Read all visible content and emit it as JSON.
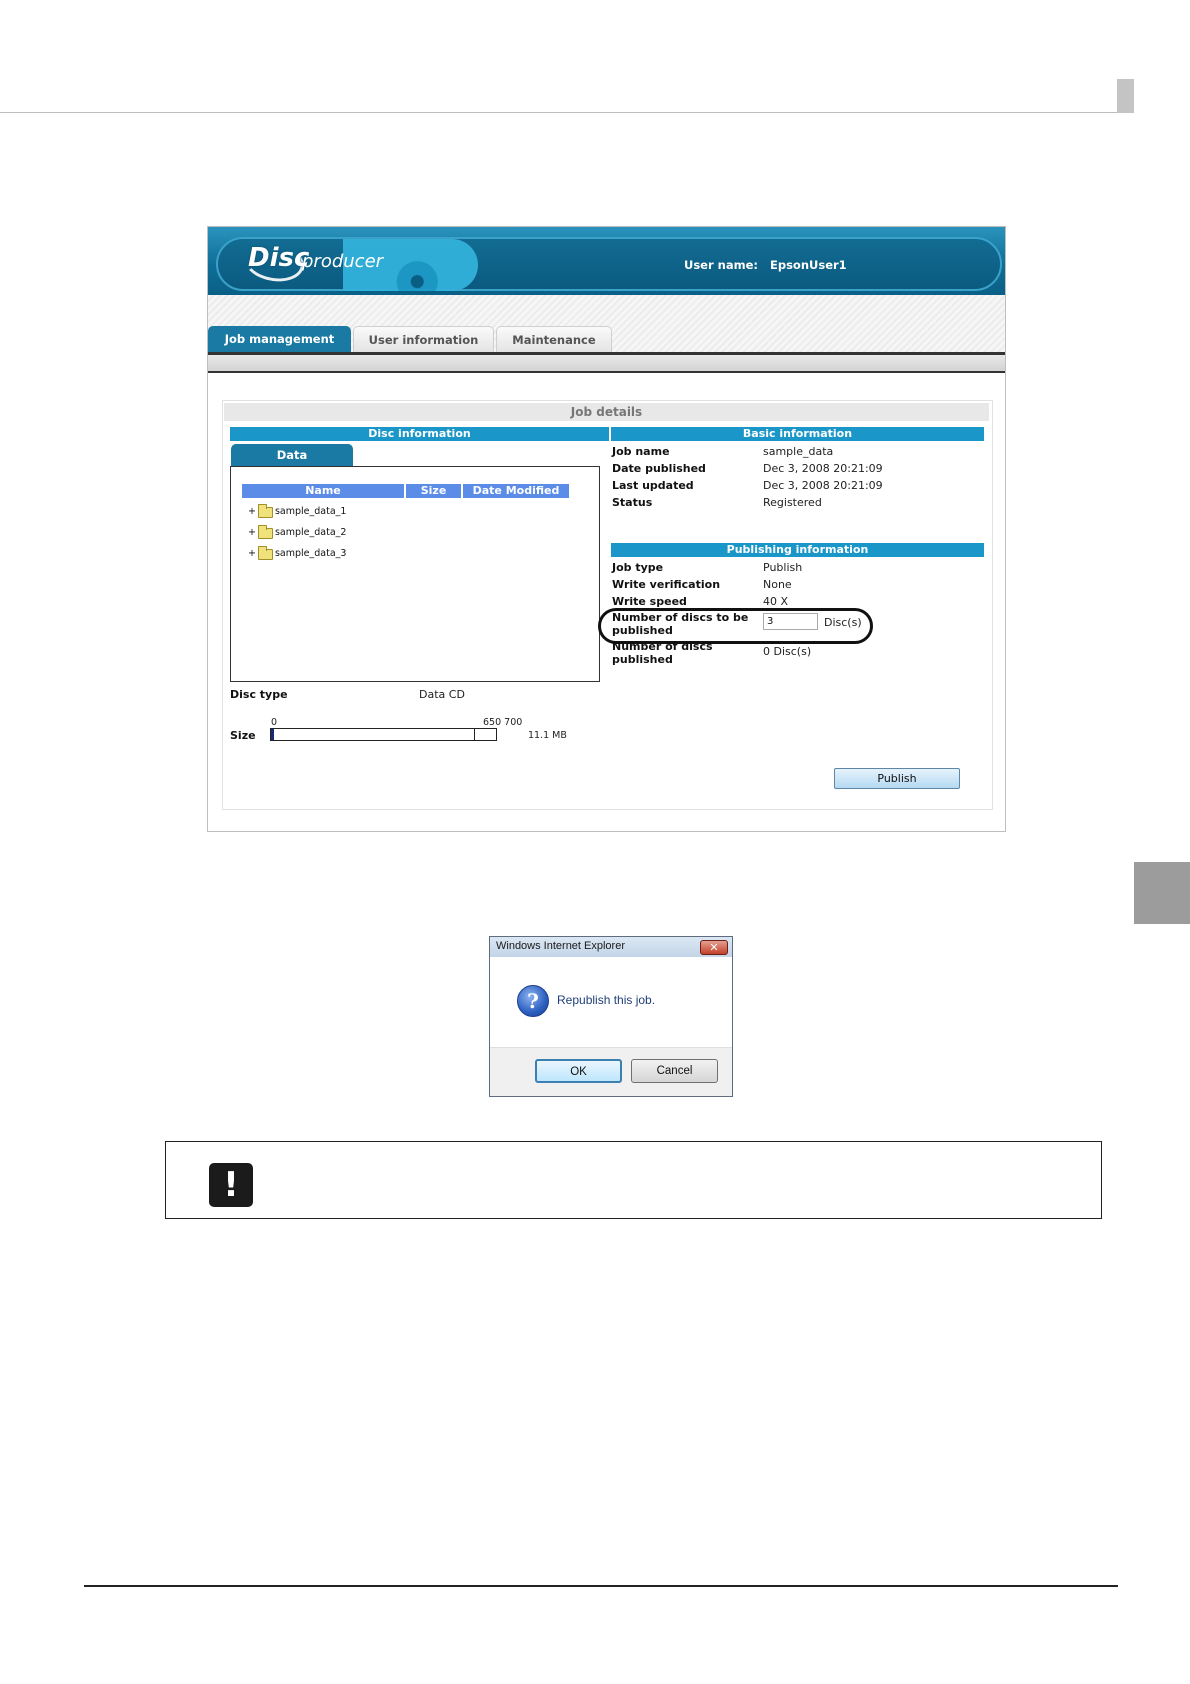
{
  "app": {
    "logo_disc": "Disc",
    "logo_producer": "producer",
    "user_label": "User name:",
    "user_value": "EpsonUser1"
  },
  "tabs": [
    {
      "label": "Job management",
      "active": true
    },
    {
      "label": "User information",
      "active": false
    },
    {
      "label": "Maintenance",
      "active": false
    }
  ],
  "job_details": {
    "title": "Job details",
    "disc_information": {
      "title": "Disc information",
      "data_tab": "Data",
      "columns": [
        "Name",
        "Size",
        "Date Modified"
      ],
      "files": [
        {
          "expand": "+",
          "name": "sample_data_1"
        },
        {
          "expand": "+",
          "name": "sample_data_2"
        },
        {
          "expand": "+",
          "name": "sample_data_3"
        }
      ],
      "disc_type_label": "Disc type",
      "disc_type_value": "Data CD",
      "size_label": "Size",
      "scale_start": "0",
      "scale_end": "650 700",
      "size_value": "11.1 MB"
    },
    "basic_information": {
      "title": "Basic information",
      "rows": [
        {
          "label": "Job name",
          "value": "sample_data"
        },
        {
          "label": "Date published",
          "value": "Dec 3, 2008 20:21:09"
        },
        {
          "label": "Last updated",
          "value": "Dec 3, 2008 20:21:09"
        },
        {
          "label": "Status",
          "value": "Registered"
        }
      ]
    },
    "publishing_information": {
      "title": "Publishing information",
      "rows": [
        {
          "label": "Job type",
          "value": "Publish"
        },
        {
          "label": "Write verification",
          "value": "None"
        },
        {
          "label": "Write speed",
          "value": "40 X"
        }
      ],
      "discs_to_publish_label_1": "Number of discs to be",
      "discs_to_publish_label_2": "published",
      "discs_to_publish_value": "3",
      "discs_unit": "Disc(s)",
      "discs_published_label_1": "Number of discs",
      "discs_published_label_2": "published",
      "discs_published_value": "0 Disc(s)"
    },
    "publish_button": "Publish"
  },
  "dialog": {
    "title": "Windows Internet Explorer",
    "close": "✕",
    "icon": "?",
    "message": "Republish this job.",
    "ok": "OK",
    "cancel": "Cancel"
  },
  "caution": {
    "icon": "!"
  },
  "colors": {
    "banner": "#0f6f98",
    "section_bar": "#1a96c9",
    "column_header": "#5b8de8",
    "active_tab": "#1a7aa3"
  }
}
